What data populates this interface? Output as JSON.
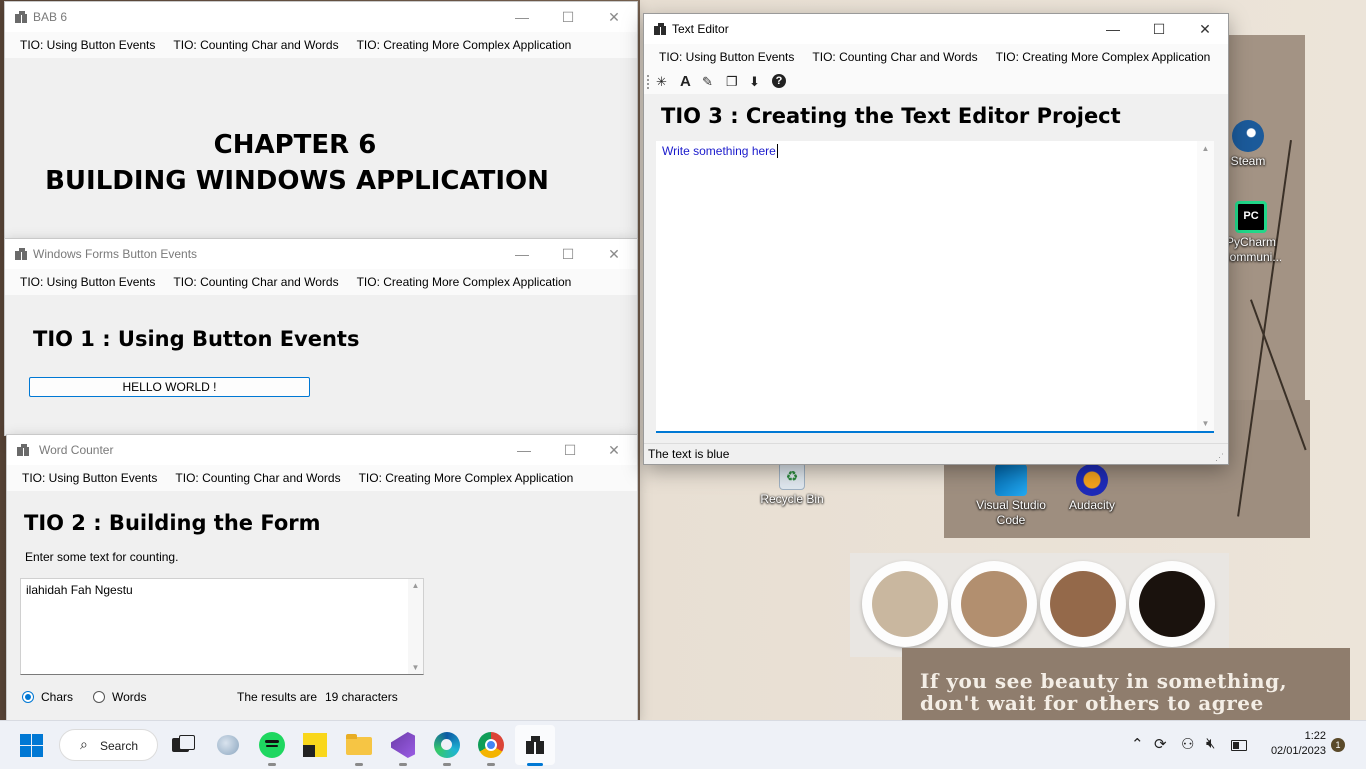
{
  "menu": {
    "item1": "TIO: Using Button Events",
    "item2": "TIO: Counting Char and Words",
    "item3": "TIO: Creating More Complex Application"
  },
  "bab6": {
    "title": "BAB 6",
    "heading_line1": "CHAPTER 6",
    "heading_line2": "BUILDING WINDOWS APPLICATION"
  },
  "button_events": {
    "title": "Windows Forms Button Events",
    "heading": "TIO 1 : Using Button Events",
    "hello_button": "HELLO WORLD !"
  },
  "word_counter": {
    "title": "Word Counter",
    "heading": "TIO 2 : Building the Form",
    "instruction": "Enter some text for counting.",
    "text_value": "ilahidah Fah Ngestu",
    "radio_chars": "Chars",
    "radio_words": "Words",
    "selected": "Chars",
    "results_label": "The results are",
    "results_value": "19 characters"
  },
  "text_editor": {
    "title": "Text Editor",
    "heading": "TIO 3 : Creating the Text Editor Project",
    "content": "Write something here",
    "content_color": "#1a1acc",
    "status": "The text is blue",
    "toolbar_icons": [
      "new-file-icon",
      "font-icon",
      "color-picker-icon",
      "copy-format-icon",
      "download-icon",
      "help-icon"
    ]
  },
  "desktop_icons": {
    "steam": "Steam",
    "pycharm": "PyCharm Communi...",
    "recycle_bin": "Recycle Bin",
    "vscode": "Visual Studio Code",
    "audacity": "Audacity"
  },
  "wallpaper": {
    "quote": "If you see beauty in something, don't wait for others to agree"
  },
  "taskbar": {
    "search_label": "Search",
    "time": "1:22",
    "date": "02/01/2023",
    "notification_count": "1",
    "accent_color": "#0078d4"
  },
  "window_controls": {
    "minimize": "—",
    "maximize": "☐",
    "close": "✕"
  }
}
